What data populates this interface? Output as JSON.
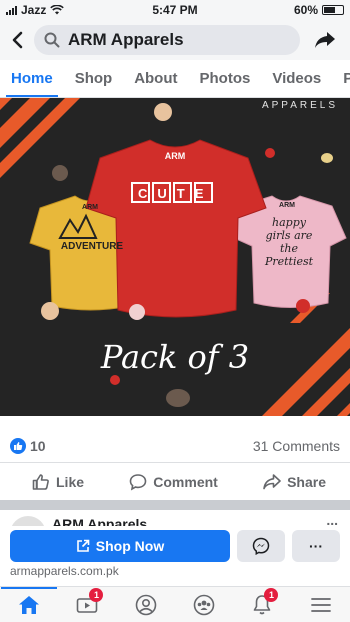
{
  "status_bar": {
    "carrier": "Jazz",
    "time": "5:47 PM",
    "battery": "60%",
    "battery_level": 0.6
  },
  "header": {
    "search_text": "ARM Apparels"
  },
  "tabs": [
    {
      "label": "Home",
      "active": true
    },
    {
      "label": "Shop"
    },
    {
      "label": "About"
    },
    {
      "label": "Photos"
    },
    {
      "label": "Videos"
    },
    {
      "label": "Po"
    }
  ],
  "post_image": {
    "brand_text": "APPARELS",
    "pack_text": "Pack of 3",
    "shirts": [
      {
        "brand": "ARM",
        "text": "ADVENTURE",
        "color": "#e8b83a"
      },
      {
        "brand": "ARM",
        "text": "CUTE",
        "color": "#d12e2a"
      },
      {
        "brand": "ARM",
        "text": "happy girls are the Prettiest",
        "color": "#eeb8c8"
      }
    ]
  },
  "reactions": {
    "likes": "10",
    "comments": "31 Comments"
  },
  "actions": {
    "like": "Like",
    "comment": "Comment",
    "share": "Share"
  },
  "next_post": {
    "name": "ARM Apparels",
    "more": "..."
  },
  "cta": {
    "shop_now": "Shop Now",
    "more": "···",
    "website": "armapparels.com.pk"
  },
  "bottom_nav": {
    "watch_badge": "1",
    "notifications_badge": "1"
  },
  "colors": {
    "accent": "#1877f2",
    "badge": "#e41e3f"
  }
}
